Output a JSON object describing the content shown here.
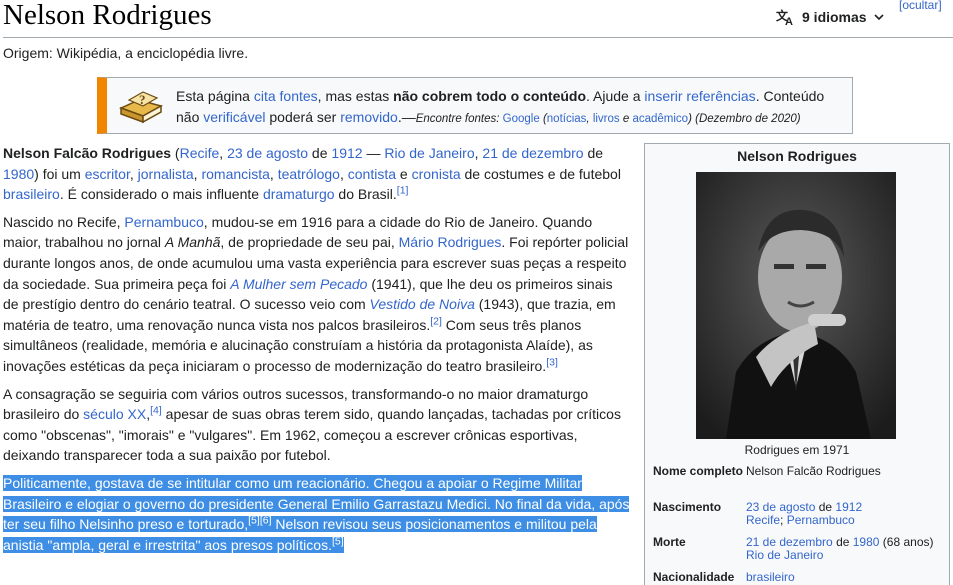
{
  "header": {
    "title": "Nelson Rodrigues",
    "languages": "9 idiomas",
    "hide": "[ocultar]",
    "subtitle": "Origem: Wikipédia, a enciclopédia livre."
  },
  "notice": {
    "t1": "Esta página ",
    "l1": "cita fontes",
    "t2": ", mas estas ",
    "b1": "não cobrem todo o conteúdo",
    "t3": ". Ajude a ",
    "l2": "inserir referências",
    "t4": ". Conteúdo não ",
    "l3": "verificável",
    "t5": " poderá ser ",
    "l4": "removido",
    "t6": ".—",
    "s1": "Encontre fontes: ",
    "l5": "Google",
    "s2": " (",
    "l6": "notícias",
    "s3": ", ",
    "l7": "livros",
    "s4": " e ",
    "l8": "acadêmico",
    "s5": ") ",
    "s6": "(Dezembro de 2020)"
  },
  "article": {
    "p1": {
      "bold": "Nelson Falcão Rodrigues",
      "t1": " (",
      "l1": "Recife",
      "t2": ", ",
      "l2": "23 de agosto",
      "t3": " de ",
      "l3": "1912",
      "t4": " — ",
      "l4": "Rio de Janeiro",
      "t5": ", ",
      "l5": "21 de dezembro",
      "t6": " de ",
      "l6": "1980",
      "t7": ") foi um ",
      "l7": "escritor",
      "t8": ", ",
      "l8": "jornalista",
      "t9": ", ",
      "l9": "romancista",
      "t10": ", ",
      "l10": "teatrólogo",
      "t11": ", ",
      "l11": "contista",
      "t12": " e ",
      "l12": "cronista",
      "t13": " de costumes e de futebol ",
      "l13": "brasileiro",
      "t14": ". É considerado o mais influente ",
      "l14": "dramaturgo",
      "t15": " do Brasil.",
      "r1": "[1]"
    },
    "p2": {
      "t1": "Nascido no Recife, ",
      "l1": "Pernambuco",
      "t2": ", mudou-se em 1916 para a cidade do Rio de Janeiro. Quando maior, trabalhou no jornal ",
      "i1": "A Manhã",
      "t3": ", de propriedade de seu pai, ",
      "l2": "Mário Rodrigues",
      "t4": ". Foi repórter policial durante longos anos, de onde acumulou uma vasta experiência para escrever suas peças a respeito da sociedade. Sua primeira peça foi ",
      "l3": "A Mulher sem Pecado",
      "t5": " (1941), que lhe deu os primeiros sinais de prestígio dentro do cenário teatral. O sucesso veio com ",
      "l4": "Vestido de Noiva",
      "t6": " (1943), que trazia, em matéria de teatro, uma renovação nunca vista nos palcos brasileiros.",
      "r1": "[2]",
      "t7": " Com seus três planos simultâneos (realidade, memória e alucinação construíam a história da protagonista Alaíde), as inovações estéticas da peça iniciaram o processo de modernização do teatro brasileiro.",
      "r2": "[3]"
    },
    "p3": {
      "t1": "A consagração se seguiria com vários outros sucessos, transformando-o no maior dramaturgo brasileiro do ",
      "l1": "século XX",
      "t2": ",",
      "r1": "[4]",
      "t3": " apesar de suas obras terem sido, quando lançadas, tachadas por críticos como \"obscenas\", \"imorais\" e \"vulgares\". Em 1962, começou a escrever crônicas esportivas, deixando transparecer toda a sua paixão por futebol."
    },
    "p4": {
      "t1": "Politicamente, gostava de se intitular como um reacionário. Chegou a apoiar o Regime Militar Brasileiro e elogiar o governo do presidente General Emilio Garrastazu Medici. No final da vida, após ter seu filho Nelsinho preso e torturado,",
      "r1": "[5]",
      "r2": "[6]",
      "t2": " Nelson revisou seus posicionamentos e militou pela anistia \"ampla, geral e irrestrita\" aos presos políticos.",
      "r3": "[5]"
    }
  },
  "infobox": {
    "title": "Nelson Rodrigues",
    "caption": "Rodrigues em 1971",
    "rows": [
      {
        "label": "Nome completo",
        "value": "Nelson Falcão Rodrigues"
      },
      {
        "label": "Nascimento",
        "v1": "23 de agosto",
        "v2": " de ",
        "v3": "1912",
        "v4": "Recife",
        "v5": "; ",
        "v6": "Pernambuco"
      },
      {
        "label": "Morte",
        "v1": "21 de dezembro",
        "v2": " de ",
        "v3": "1980",
        "v4": " (68 anos)",
        "v5": "Rio de Janeiro"
      },
      {
        "label": "Nacionalidade",
        "value": "brasileiro"
      }
    ]
  },
  "colors": {
    "link": "#3366cc",
    "selection": "#3d8ee4",
    "notice_border": "#f28500"
  }
}
